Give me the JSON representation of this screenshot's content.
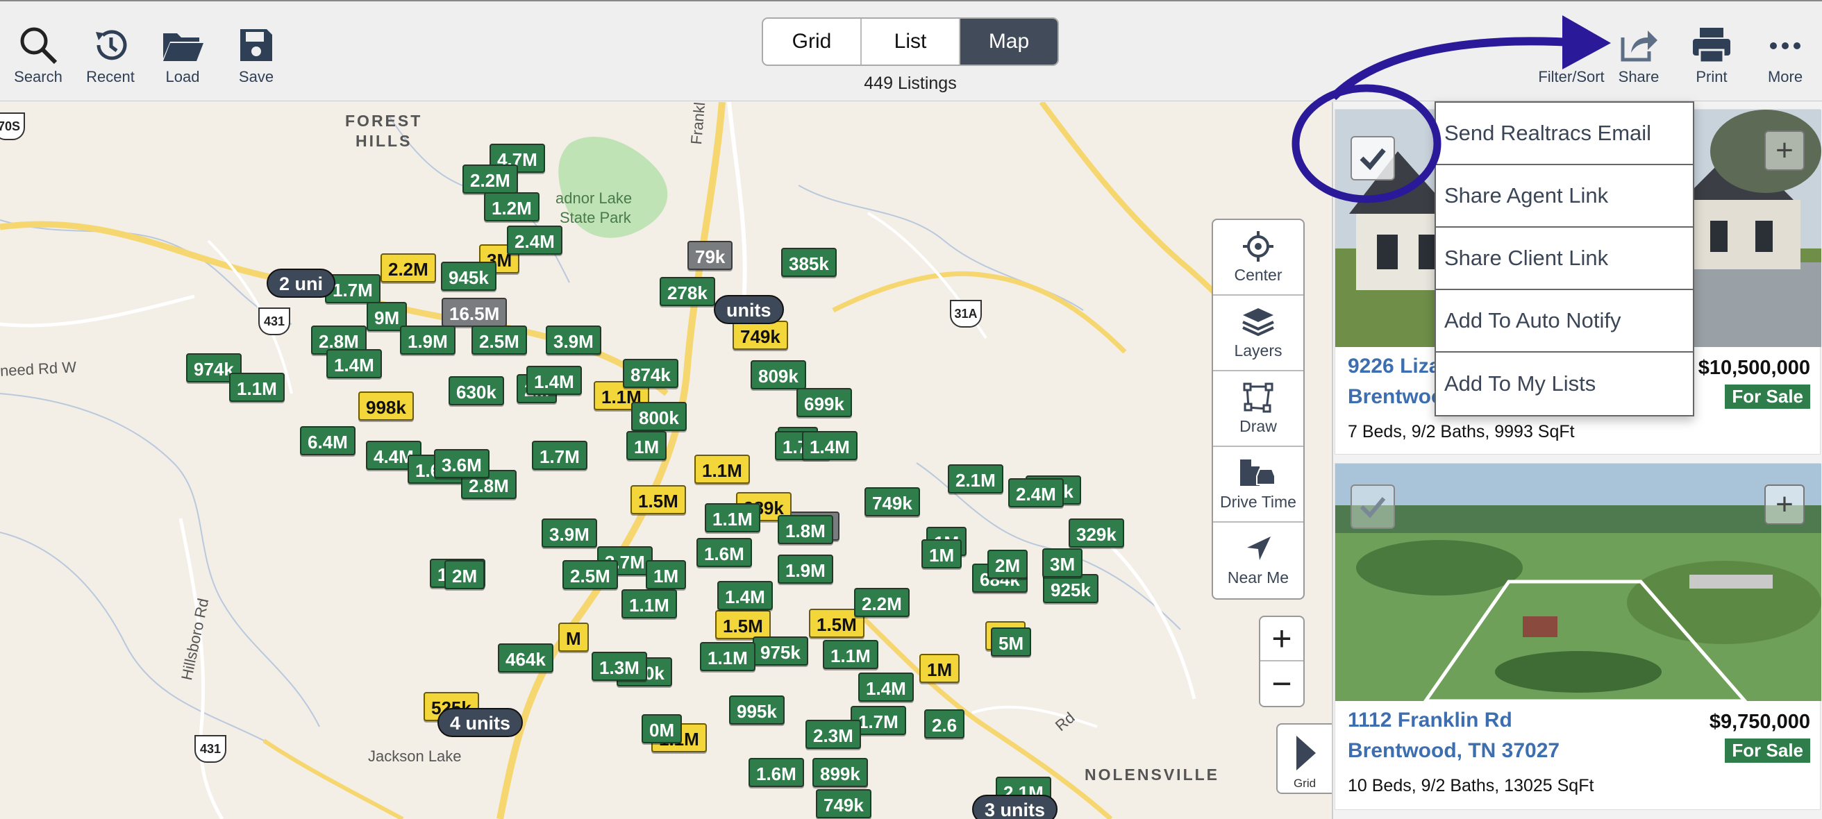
{
  "toolbar": {
    "left_items": [
      {
        "label": "Search",
        "icon": "search-icon"
      },
      {
        "label": "Recent",
        "icon": "history-icon"
      },
      {
        "label": "Load",
        "icon": "folder-icon"
      },
      {
        "label": "Save",
        "icon": "floppy-icon"
      }
    ],
    "view_tabs": [
      "Grid",
      "List",
      "Map"
    ],
    "active_view": "Map",
    "listing_count": "449 Listings",
    "right_items": [
      {
        "label": "Filter/Sort",
        "icon": "filter-icon"
      },
      {
        "label": "Share",
        "icon": "share-icon"
      },
      {
        "label": "Print",
        "icon": "printer-icon"
      },
      {
        "label": "More",
        "icon": "more-icon"
      }
    ]
  },
  "map": {
    "places": [
      "FOREST",
      "HILLS",
      "NOLENSVILLE"
    ],
    "park": [
      "adnor Lake",
      "State Park"
    ],
    "lake": "Jackson Lake",
    "roads": [
      "Franklin P",
      "need Rd W",
      "Hillsboro Rd",
      "Rd"
    ],
    "route_shields": [
      "431",
      "31A",
      "431",
      "70S"
    ],
    "tools": [
      "Center",
      "Layers",
      "Draw",
      "Drive Time",
      "Near Me"
    ],
    "zoom_in": "+",
    "zoom_out": "−",
    "grid_tab": "Grid",
    "unit_pills": [
      "2 uni",
      "units",
      "4 units",
      "3 units"
    ],
    "markers_green": [
      "4.7M",
      "2.2M",
      "1.2M",
      "2.4M",
      "945k",
      "1.7M",
      "9M",
      "2.8M",
      "1.9M",
      "2.5M",
      "3.9M",
      "1.4M",
      "974k",
      "1.1M",
      "6.4M",
      "4.4M",
      "1.6M",
      "2.8M",
      "1.7M",
      "630k",
      "2M",
      "1.4M",
      "874k",
      "809k",
      "699k",
      "800k",
      "1M",
      "1M",
      "1.7M",
      "1.4M",
      "278k",
      "385k",
      "2.1M",
      "369k",
      "329k",
      "749k",
      "1M",
      "925k",
      "684k",
      "1.8M",
      "1.1M",
      "3.9M",
      "3.7M",
      "1.6M",
      "1.9M",
      "1.1M",
      "2M",
      "2.5M",
      "1M",
      "1.1M",
      "1.4M",
      "2.2M",
      "464k",
      "960k",
      "975k",
      "1.1M",
      "995k",
      "1.7M",
      "899k",
      "749k",
      "2.1M",
      "1.6M",
      "2.3M",
      "1.4M",
      "1.3M",
      "1.1M",
      "3M",
      "2.6",
      "1M",
      "2M",
      "2.4M",
      "5M",
      "3.6M",
      "0M"
    ],
    "markers_yellow": [
      "2.2M",
      "3M",
      "998k",
      "1.1M",
      "749k",
      "1.1M",
      "1.5M",
      "989k",
      "1.5M",
      "1.5M",
      "1M",
      "1M",
      "1.1M",
      "525k",
      "M",
      "1.4"
    ],
    "markers_gray": [
      "1.8M",
      "79k",
      "16.5M"
    ]
  },
  "share_menu": [
    "Send Realtracs Email",
    "Share Agent Link",
    "Share Client Link",
    "Add To Auto Notify",
    "Add To My Lists"
  ],
  "listings": [
    {
      "addr1": "9226 Liza",
      "addr2": "Brentwoo",
      "price": "$10,500,000",
      "status": "For Sale",
      "details": "7 Beds, 9/2 Baths, 9993 SqFt"
    },
    {
      "addr1": "1112 Franklin Rd",
      "addr2": "Brentwood, TN 37027",
      "price": "$9,750,000",
      "status": "For Sale",
      "details": "10 Beds, 9/2 Baths, 13025 SqFt"
    }
  ],
  "colors": {
    "accent_dark": "#414b5a",
    "marker_green": "#2e7d4a",
    "marker_yellow": "#f3d63a",
    "link_blue": "#3d6fb0",
    "annotation": "#2a1a9a"
  }
}
